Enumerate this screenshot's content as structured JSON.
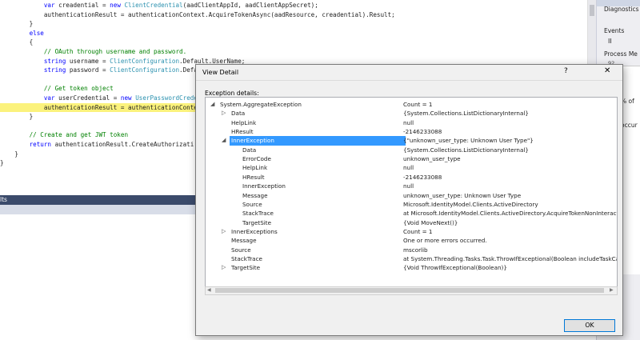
{
  "editor": {
    "lines": [
      {
        "tokens": [
          {
            "c": "kw",
            "t": "            var "
          },
          {
            "c": "",
            "t": "creadential = "
          },
          {
            "c": "kw",
            "t": "new "
          },
          {
            "c": "ty",
            "t": "ClientCredential"
          },
          {
            "c": "",
            "t": "(aadClientAppId, aadClientAppSecret);"
          }
        ]
      },
      {
        "tokens": [
          {
            "c": "",
            "t": "            authenticationResult = authenticationContext.AcquireTokenAsync(aadResource, creadential).Result;"
          }
        ]
      },
      {
        "tokens": [
          {
            "c": "",
            "t": "        }"
          }
        ]
      },
      {
        "tokens": [
          {
            "c": "kw",
            "t": "        else"
          }
        ]
      },
      {
        "tokens": [
          {
            "c": "",
            "t": "        {"
          }
        ]
      },
      {
        "tokens": [
          {
            "c": "cm",
            "t": "            // OAuth through username and password."
          }
        ]
      },
      {
        "tokens": [
          {
            "c": "kw",
            "t": "            string "
          },
          {
            "c": "",
            "t": "username = "
          },
          {
            "c": "ty",
            "t": "ClientConfiguration"
          },
          {
            "c": "",
            "t": ".Default.UserName;"
          }
        ]
      },
      {
        "tokens": [
          {
            "c": "kw",
            "t": "            string "
          },
          {
            "c": "",
            "t": "password = "
          },
          {
            "c": "ty",
            "t": "ClientConfiguration"
          },
          {
            "c": "",
            "t": ".Default.Password;"
          }
        ]
      },
      {
        "tokens": [
          {
            "c": "",
            "t": ""
          }
        ]
      },
      {
        "tokens": [
          {
            "c": "cm",
            "t": "            // Get token object"
          }
        ]
      },
      {
        "tokens": [
          {
            "c": "kw",
            "t": "            var "
          },
          {
            "c": "",
            "t": "userCredential = "
          },
          {
            "c": "kw",
            "t": "new "
          },
          {
            "c": "ty",
            "t": "UserPasswordCrede"
          }
        ]
      },
      {
        "tokens": [
          {
            "c": "",
            "t": "            authenticationResult = authenticationConte"
          }
        ],
        "highlight": true
      },
      {
        "tokens": [
          {
            "c": "",
            "t": "        }"
          }
        ]
      },
      {
        "tokens": [
          {
            "c": "",
            "t": ""
          }
        ]
      },
      {
        "tokens": [
          {
            "c": "cm",
            "t": "        // Create and get JWT token"
          }
        ]
      },
      {
        "tokens": [
          {
            "c": "kw",
            "t": "        return "
          },
          {
            "c": "",
            "t": "authenticationResult.CreateAuthorizati"
          }
        ]
      },
      {
        "tokens": [
          {
            "c": "",
            "t": "    }"
          }
        ]
      },
      {
        "tokens": [
          {
            "c": "",
            "t": "}"
          }
        ]
      }
    ]
  },
  "bottom_panel": {
    "title": "lts"
  },
  "right_panel": {
    "title": "Diagnostics",
    "events": "Events",
    "pause": "II",
    "process_memory": "Process Me",
    "number": "92",
    "pct": "% of",
    "occur": "occur"
  },
  "dialog": {
    "title": "View Detail",
    "help": "?",
    "close": "✕",
    "exception_label": "Exception details:",
    "ok": "OK",
    "rows": [
      {
        "level": 0,
        "exp": "◢",
        "name": "System.AggregateException",
        "val": "Count = 1"
      },
      {
        "level": 1,
        "exp": "▷",
        "name": "Data",
        "val": "{System.Collections.ListDictionaryInternal}"
      },
      {
        "level": 1,
        "exp": "",
        "name": "HelpLink",
        "val": "null"
      },
      {
        "level": 1,
        "exp": "",
        "name": "HResult",
        "val": "-2146233088"
      },
      {
        "level": 1,
        "exp": "◢",
        "name": "InnerException",
        "val": "{\"unknown_user_type: Unknown User Type\"}",
        "selected": true
      },
      {
        "level": 2,
        "exp": "",
        "name": "Data",
        "val": "{System.Collections.ListDictionaryInternal}"
      },
      {
        "level": 2,
        "exp": "",
        "name": "ErrorCode",
        "val": "unknown_user_type"
      },
      {
        "level": 2,
        "exp": "",
        "name": "HelpLink",
        "val": "null"
      },
      {
        "level": 2,
        "exp": "",
        "name": "HResult",
        "val": "-2146233088"
      },
      {
        "level": 2,
        "exp": "",
        "name": "InnerException",
        "val": "null"
      },
      {
        "level": 2,
        "exp": "",
        "name": "Message",
        "val": "unknown_user_type: Unknown User Type"
      },
      {
        "level": 2,
        "exp": "",
        "name": "Source",
        "val": "Microsoft.IdentityModel.Clients.ActiveDirectory"
      },
      {
        "level": 2,
        "exp": "",
        "name": "StackTrace",
        "val": "   at Microsoft.IdentityModel.Clients.ActiveDirectory.AcquireTokenNonInteractive"
      },
      {
        "level": 2,
        "exp": "",
        "name": "TargetSite",
        "val": "{Void MoveNext()}"
      },
      {
        "level": 1,
        "exp": "▷",
        "name": "InnerExceptions",
        "val": "Count = 1"
      },
      {
        "level": 1,
        "exp": "",
        "name": "Message",
        "val": "One or more errors occurred."
      },
      {
        "level": 1,
        "exp": "",
        "name": "Source",
        "val": "mscorlib"
      },
      {
        "level": 1,
        "exp": "",
        "name": "StackTrace",
        "val": "   at System.Threading.Tasks.Task.ThrowIfExceptional(Boolean includeTaskCancel"
      },
      {
        "level": 1,
        "exp": "▷",
        "name": "TargetSite",
        "val": "{Void ThrowIfExceptional(Boolean)}"
      }
    ]
  }
}
